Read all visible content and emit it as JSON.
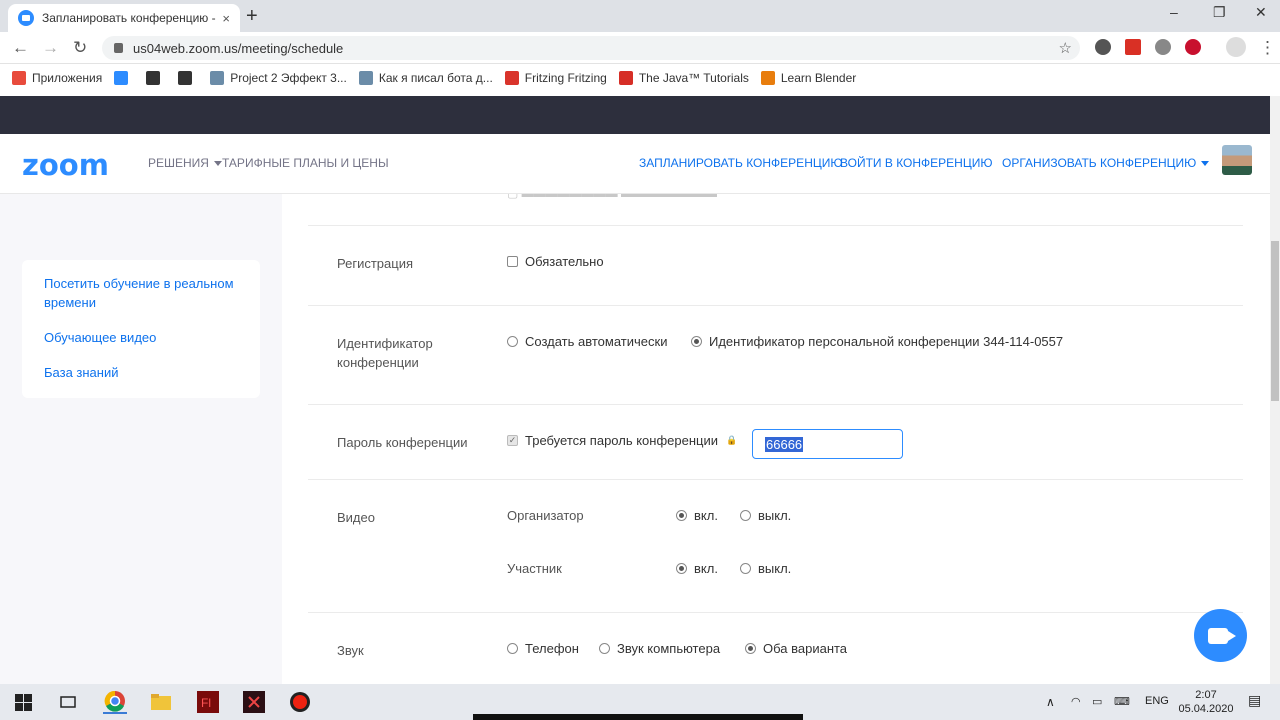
{
  "browser": {
    "tab_title": "Запланировать конференцию - ",
    "tab_close": "×",
    "new_tab": "+",
    "url": "us04web.zoom.us/meeting/schedule",
    "win_min": "–",
    "win_max": "❐",
    "win_close": "✕",
    "bookmarks": [
      {
        "label": "Приложения",
        "color": "#e84b3c"
      },
      {
        "label": "",
        "color": "#2d8cff"
      },
      {
        "label": "",
        "color": "#333333"
      },
      {
        "label": "",
        "color": "#333333"
      },
      {
        "label": "Project 2 Эффект 3...",
        "color": "#6b8ca8"
      },
      {
        "label": "Как я писал бота д...",
        "color": "#6b8ca8"
      },
      {
        "label": "Fritzing Fritzing",
        "color": "#d9342b"
      },
      {
        "label": "The Java™ Tutorials",
        "color": "#d62e26"
      },
      {
        "label": "Learn Blender",
        "color": "#e87d0d"
      }
    ]
  },
  "header": {
    "logo": "zoom",
    "nav_solutions": "РЕШЕНИЯ",
    "nav_plans": "ТАРИФНЫЕ ПЛАНЫ И ЦЕНЫ",
    "nav_schedule": "ЗАПЛАНИРОВАТЬ КОНФЕРЕНЦИЮ",
    "nav_join": "ВОЙТИ В КОНФЕРЕНЦИЮ",
    "nav_host": "ОРГАНИЗОВАТЬ КОНФЕРЕНЦИЮ"
  },
  "sidebar": {
    "items": [
      {
        "label": "Посетить обучение в реальном времени"
      },
      {
        "label": "Обучающее видео"
      },
      {
        "label": "База знаний"
      }
    ]
  },
  "form": {
    "registration_label": "Регистрация",
    "registration_option": "Обязательно",
    "meeting_id_label": "Идентификатор конференции",
    "meeting_id_auto": "Создать автоматически",
    "meeting_id_personal": "Идентификатор персональной конференции 344-114-0557",
    "password_label": "Пароль конференции",
    "password_option": "Требуется пароль конференции",
    "password_value": "66666",
    "video_label": "Видео",
    "video_host": "Организатор",
    "video_participant": "Участник",
    "on": "вкл.",
    "off": "выкл.",
    "audio_label": "Звук",
    "audio_phone": "Телефон",
    "audio_computer": "Звук компьютера",
    "audio_both": "Оба варианта"
  },
  "taskbar": {
    "lang": "ENG",
    "time": "2:07",
    "date": "05.04.2020"
  },
  "colors": {
    "zoom_blue": "#2d8cff",
    "link_blue": "#0e72ed",
    "dark_band": "#2d2f3d"
  }
}
